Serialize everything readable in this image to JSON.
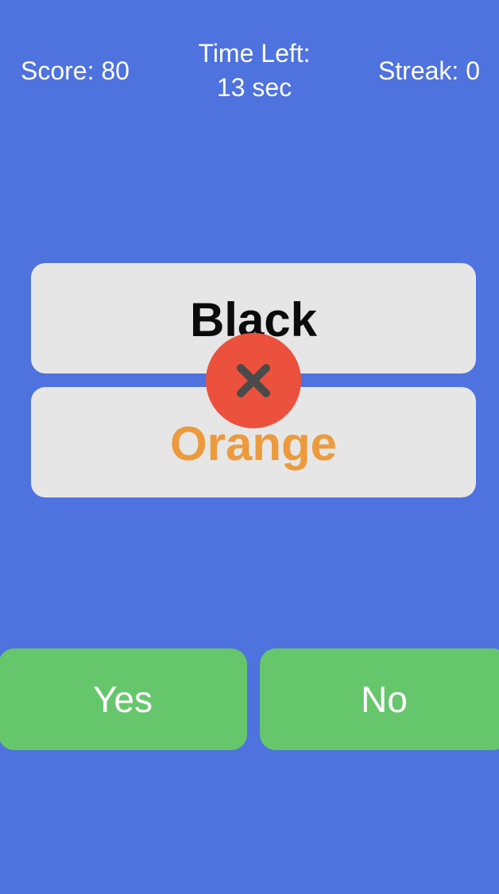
{
  "hud": {
    "score": "Score: 80",
    "time_line1": "Time Left:",
    "time_line2": "13 sec",
    "streak": "Streak: 0"
  },
  "cards": {
    "top_word": "Black",
    "top_color": "#0b0b0b",
    "bottom_word": "Orange",
    "bottom_color": "#ec9a3c"
  },
  "feedback": {
    "icon": "close-icon",
    "result": "wrong",
    "badge_color": "#ec513d"
  },
  "answers": {
    "yes_label": "Yes",
    "no_label": "No",
    "button_color": "#66c66b"
  },
  "theme": {
    "background": "#4e72de",
    "card_background": "#e6e6e6"
  }
}
